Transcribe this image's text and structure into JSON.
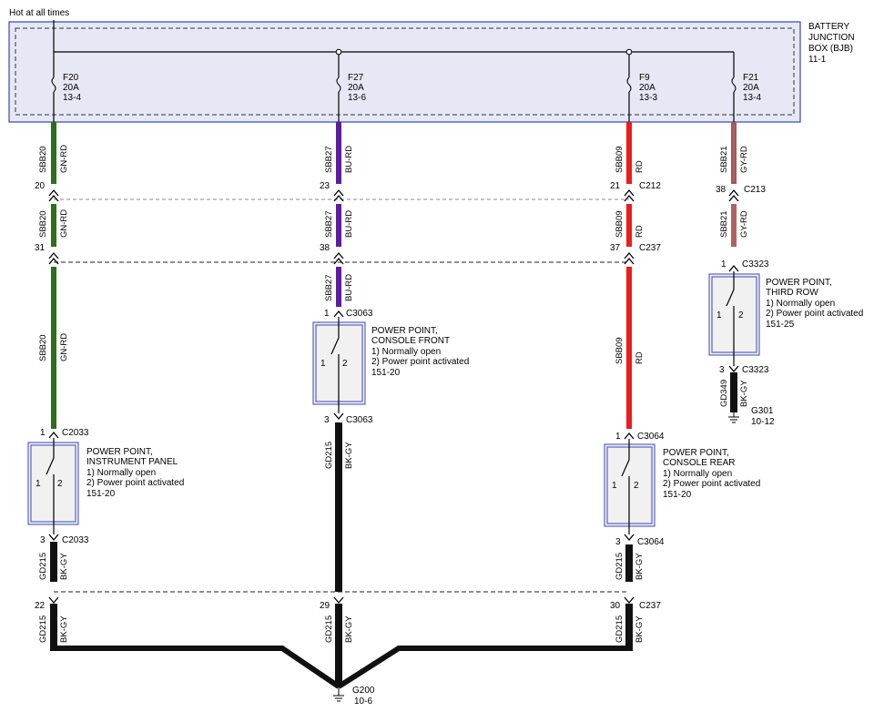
{
  "header": {
    "power_label": "Hot at all times",
    "bjb_name": [
      "BATTERY",
      "JUNCTION",
      "BOX (BJB)",
      "11-1"
    ]
  },
  "colors": {
    "wire_green": "#2e6f1b",
    "wire_purple": "#5d1d9c",
    "wire_red": "#ee1b1b",
    "wire_gray_red": "#b06262",
    "wire_black": "#111111",
    "box_border": "#3747b7",
    "box_fill": "#e6e8f5"
  },
  "fuses": [
    {
      "name": "F20",
      "rating": "20A",
      "ref": "13-4"
    },
    {
      "name": "F27",
      "rating": "20A",
      "ref": "13-6"
    },
    {
      "name": "F9",
      "rating": "20A",
      "ref": "13-3"
    },
    {
      "name": "F21",
      "rating": "20A",
      "ref": "13-4"
    }
  ],
  "circuits": {
    "c1": {
      "circuit": "SBB20",
      "color": "GN-RD",
      "pins": [
        {
          "pin": "20",
          "connector": ""
        },
        {
          "pin": "31",
          "connector": ""
        },
        {
          "pin": "1",
          "connector": "C2033"
        },
        {
          "pin": "3",
          "connector": "C2033"
        },
        {
          "pin": "22",
          "connector": ""
        }
      ],
      "device": [
        "POWER POINT,",
        "INSTRUMENT PANEL",
        "1) Normally open",
        "2) Power point activated",
        "151-20"
      ],
      "ground_circuit": "GD215",
      "ground_color": "BK-GY"
    },
    "c2": {
      "circuit": "SBB27",
      "color": "BU-RD",
      "pins": [
        {
          "pin": "23",
          "connector": ""
        },
        {
          "pin": "38",
          "connector": ""
        },
        {
          "pin": "1",
          "connector": "C3063"
        },
        {
          "pin": "3",
          "connector": "C3063"
        },
        {
          "pin": "29",
          "connector": ""
        }
      ],
      "device": [
        "POWER POINT,",
        "CONSOLE FRONT",
        "1) Normally open",
        "2) Power point activated",
        "151-20"
      ],
      "ground_circuit": "GD215",
      "ground_color": "BK-GY"
    },
    "c3": {
      "circuit": "SBB09",
      "color": "RD",
      "pins": [
        {
          "pin": "21",
          "connector": "C212"
        },
        {
          "pin": "37",
          "connector": "C237"
        },
        {
          "pin": "1",
          "connector": "C3064"
        },
        {
          "pin": "3",
          "connector": "C3064"
        },
        {
          "pin": "30",
          "connector": "C237"
        }
      ],
      "device": [
        "POWER POINT,",
        "CONSOLE REAR",
        "1) Normally open",
        "2) Power point activated",
        "151-20"
      ],
      "ground_circuit": "GD215",
      "ground_color": "BK-GY"
    },
    "c4": {
      "circuit": "SBB21",
      "color": "GY-RD",
      "pins": [
        {
          "pin": "38",
          "connector": "C213"
        },
        {
          "pin": "1",
          "connector": "C3323"
        },
        {
          "pin": "3",
          "connector": "C3323"
        }
      ],
      "device": [
        "POWER POINT,",
        "THIRD ROW",
        "1) Normally open",
        "2) Power point activated",
        "151-25"
      ],
      "ground_circuit": "GD349",
      "ground_color": "BK-GY",
      "ground": {
        "name": "G301",
        "ref": "10-12"
      }
    }
  },
  "switch_pins": {
    "a": "1",
    "b": "2"
  },
  "main_ground": {
    "name": "G200",
    "ref": "10-6"
  }
}
